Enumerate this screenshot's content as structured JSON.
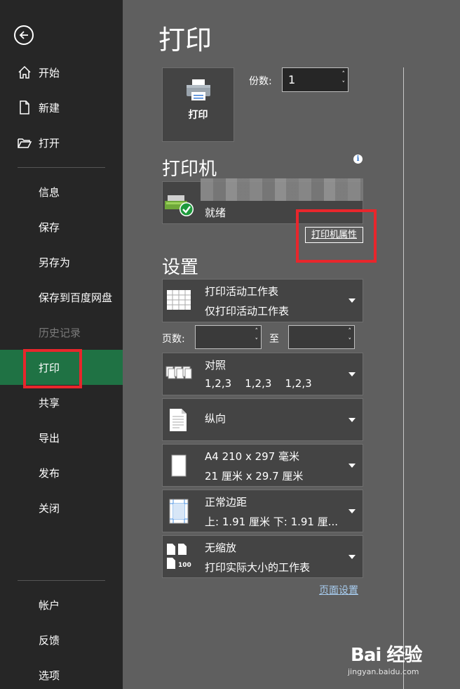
{
  "sidebar": {
    "items": [
      {
        "label": "开始",
        "icon": "home-icon"
      },
      {
        "label": "新建",
        "icon": "new-document-icon"
      },
      {
        "label": "打开",
        "icon": "folder-open-icon"
      },
      {
        "label": "信息"
      },
      {
        "label": "保存"
      },
      {
        "label": "另存为"
      },
      {
        "label": "保存到百度网盘"
      },
      {
        "label": "历史记录",
        "disabled": true
      },
      {
        "label": "打印",
        "active": true
      },
      {
        "label": "共享"
      },
      {
        "label": "导出"
      },
      {
        "label": "发布"
      },
      {
        "label": "关闭"
      }
    ],
    "bottom_items": [
      {
        "label": "帐户"
      },
      {
        "label": "反馈"
      },
      {
        "label": "选项"
      }
    ],
    "active_color": "#1f7244"
  },
  "main": {
    "title": "打印",
    "print_button_label": "打印",
    "copies_label": "份数:",
    "copies_value": "1",
    "printer_section": "打印机",
    "printer_status": "就绪",
    "printer_properties_link": "打印机属性",
    "settings_section": "设置",
    "settings": [
      {
        "line1": "打印活动工作表",
        "line2": "仅打印活动工作表",
        "icon": "sheet-grid-icon"
      },
      {
        "line1": "对照",
        "line2": "1,2,3    1,2,3    1,2,3",
        "icon": "collate-icon"
      },
      {
        "line1": "纵向",
        "icon": "portrait-icon"
      },
      {
        "line1": "A4 210 x 297 毫米",
        "line2": "21 厘米 x 29.7 厘米",
        "icon": "paper-size-icon"
      },
      {
        "line1": "正常边距",
        "line2": "上: 1.91 厘米 下: 1.91 厘...",
        "icon": "margins-icon"
      },
      {
        "line1": "无缩放",
        "line2": "打印实际大小的工作表",
        "icon": "scaling-icon",
        "icon_text": "100"
      }
    ],
    "pages_label": "页数:",
    "to_label": "至",
    "page_setup_link": "页面设置"
  },
  "watermark": {
    "brand": "Bai 经验",
    "sub": "jingyan.baidu.com"
  },
  "highlight_color": "#e8262c"
}
